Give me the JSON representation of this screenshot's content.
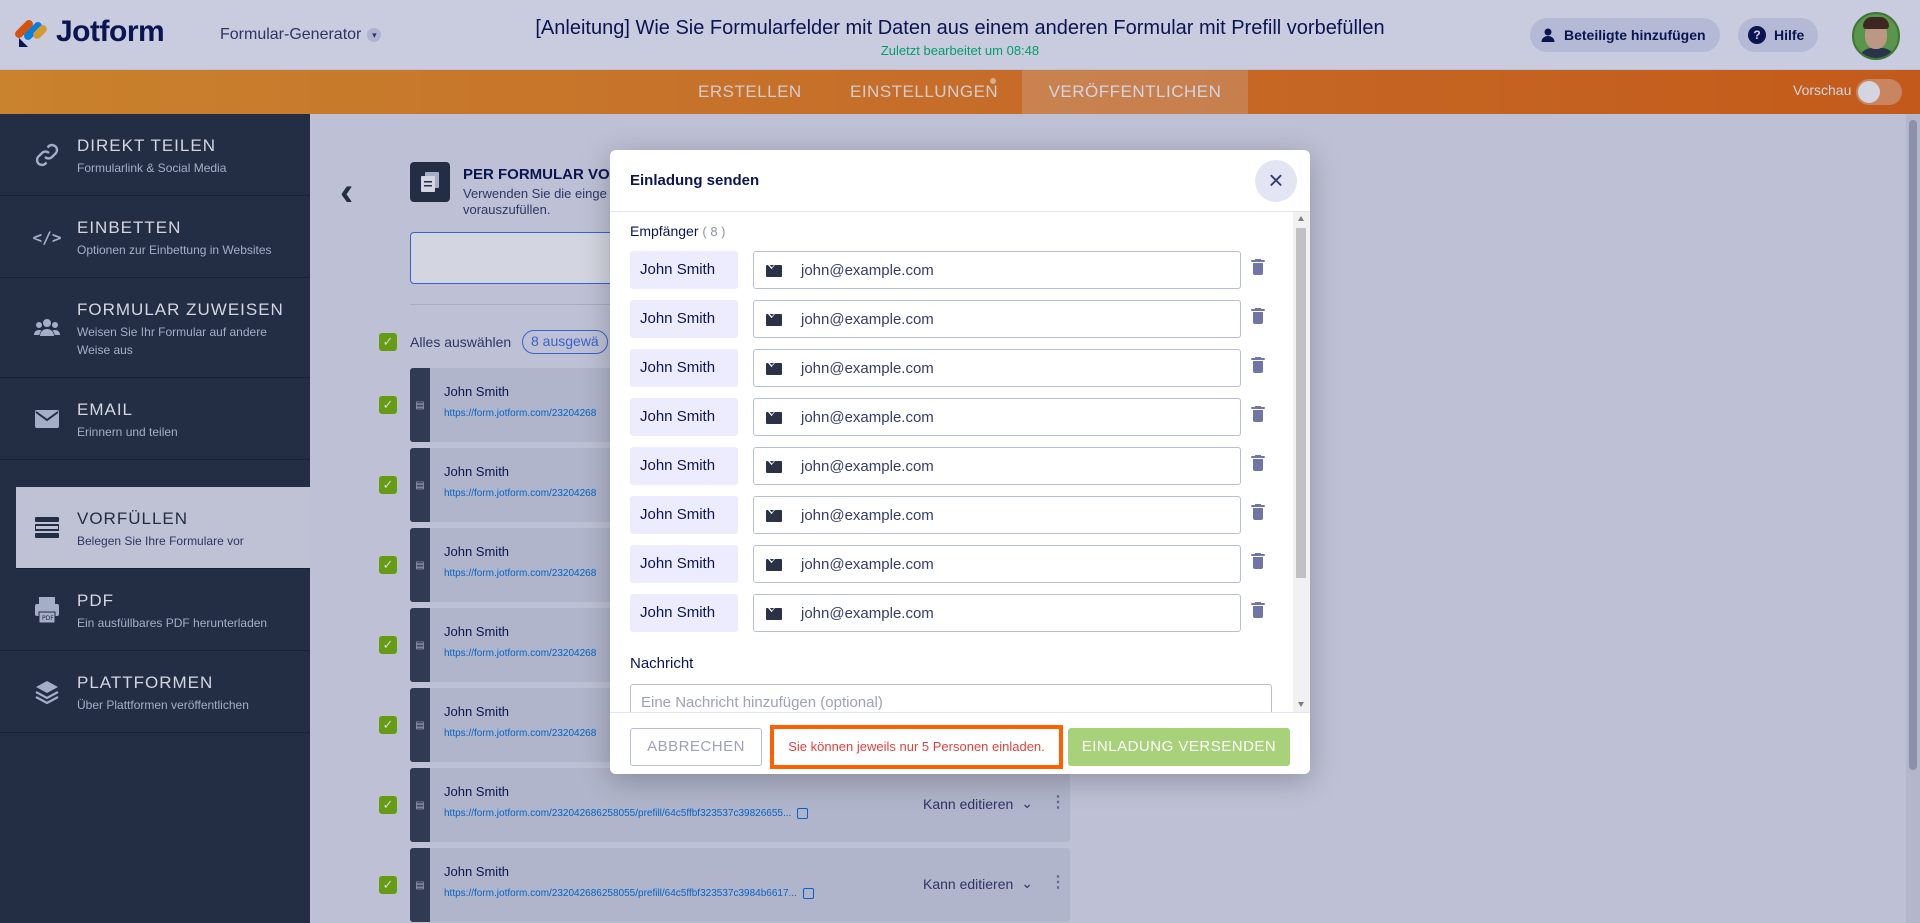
{
  "header": {
    "logo_text": "Jotform",
    "builder_label": "Formular-Generator",
    "form_title": "[Anleitung] Wie Sie Formularfelder mit Daten aus einem anderen Formular mit Prefill vorbefüllen",
    "last_edited": "Zuletzt bearbeitet um 08:48",
    "collab_label": "Beteiligte hinzufügen",
    "help_label": "Hilfe"
  },
  "nav": {
    "tabs": [
      {
        "label": "ERSTELLEN"
      },
      {
        "label": "EINSTELLUNGEN"
      },
      {
        "label": "VERÖFFENTLICHEN"
      }
    ],
    "preview_label": "Vorschau"
  },
  "sidebar": {
    "items": [
      {
        "title": "DIREKT TEILEN",
        "sub": "Formularlink & Social Media",
        "icon": "link-icon"
      },
      {
        "title": "EINBETTEN",
        "sub": "Optionen zur Einbettung in Websites",
        "icon": "code-icon"
      },
      {
        "title": "FORMULAR ZUWEISEN",
        "sub": "Weisen Sie Ihr Formular auf andere Weise aus",
        "icon": "users-icon"
      },
      {
        "title": "EMAIL",
        "sub": "Erinnern und teilen",
        "icon": "mail-icon"
      },
      {
        "title": "VORFÜLLEN",
        "sub": "Belegen Sie Ihre Formulare vor",
        "icon": "prefill-icon"
      },
      {
        "title": "PDF",
        "sub": "Ein ausfüllbares PDF herunterladen",
        "icon": "pdf-icon"
      },
      {
        "title": "PLATTFORMEN",
        "sub": "Über Plattformen veröffentlichen",
        "icon": "layers-icon"
      }
    ]
  },
  "main": {
    "prefill_title": "PER FORMULAR VO",
    "prefill_desc": "Verwenden Sie die einge vorauszufüllen.",
    "select_all_label": "Alles auswählen",
    "selected_badge": "8 ausgewä",
    "rows": [
      {
        "name": "John Smith",
        "link": "https://form.jotform.com/23204268",
        "perm": ""
      },
      {
        "name": "John Smith",
        "link": "https://form.jotform.com/23204268",
        "perm": ""
      },
      {
        "name": "John Smith",
        "link": "https://form.jotform.com/23204268",
        "perm": ""
      },
      {
        "name": "John Smith",
        "link": "https://form.jotform.com/23204268",
        "perm": ""
      },
      {
        "name": "John Smith",
        "link": "https://form.jotform.com/23204268",
        "perm": ""
      },
      {
        "name": "John Smith",
        "link": "https://form.jotform.com/232042686258055/prefill/64c5ffbf323537c39826655...",
        "perm": "Kann editieren"
      },
      {
        "name": "John Smith",
        "link": "https://form.jotform.com/232042686258055/prefill/64c5ffbf323537c3984b6617...",
        "perm": "Kann editieren"
      }
    ]
  },
  "modal": {
    "title": "Einladung senden",
    "recipients_label": "Empfänger",
    "recipients_count": "( 8 )",
    "recipients": [
      {
        "name": "John Smith",
        "email": "john@example.com"
      },
      {
        "name": "John Smith",
        "email": "john@example.com"
      },
      {
        "name": "John Smith",
        "email": "john@example.com"
      },
      {
        "name": "John Smith",
        "email": "john@example.com"
      },
      {
        "name": "John Smith",
        "email": "john@example.com"
      },
      {
        "name": "John Smith",
        "email": "john@example.com"
      },
      {
        "name": "John Smith",
        "email": "john@example.com"
      },
      {
        "name": "John Smith",
        "email": "john@example.com"
      }
    ],
    "message_label": "Nachricht",
    "message_placeholder": "Eine Nachricht hinzufügen (optional)",
    "cancel_label": "ABBRECHEN",
    "warning": "Sie können jeweils nur 5 Personen einladen.",
    "send_label": "EINLADUNG VERSENDEN"
  },
  "colors": {
    "accent_orange": "#ff6100",
    "sidebar_bg": "#293241",
    "check_green": "#78bb07",
    "send_disabled": "#a8d27a",
    "warning_red": "#e5403c"
  }
}
